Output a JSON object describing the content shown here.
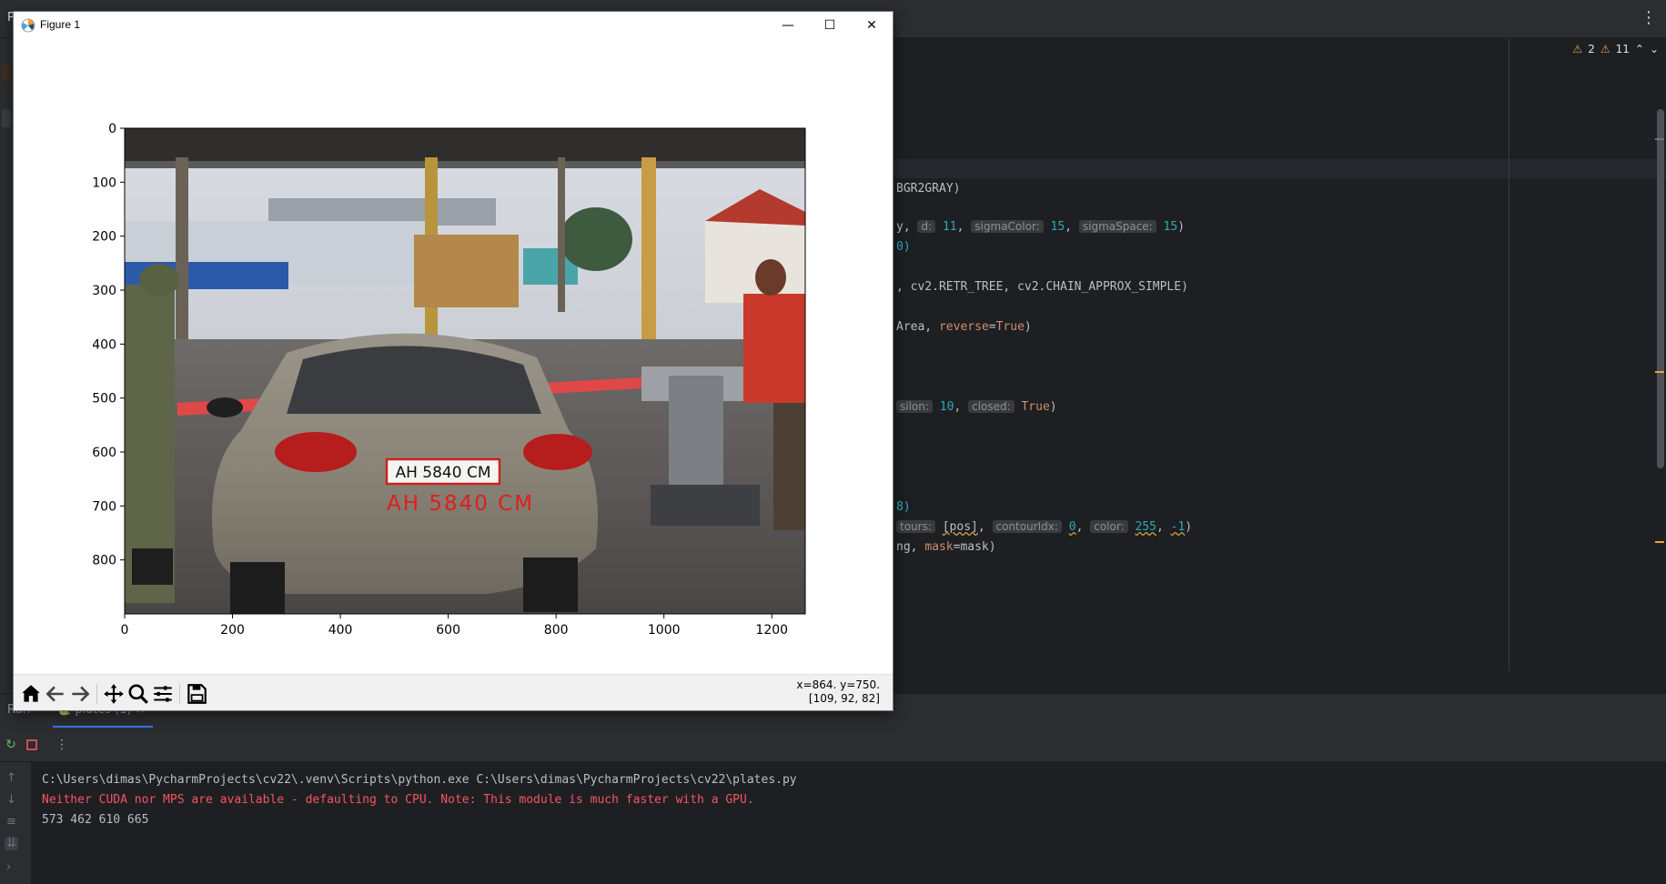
{
  "ide": {
    "title_fragment": "P",
    "more_icon": "vertical-dots-icon",
    "inspections": {
      "warnings": "2",
      "weak_warnings": "11"
    },
    "code_lines": [
      {
        "text": "BGR2GRAY)"
      },
      {
        "pre": "y, ",
        "hint1": "d:",
        "v1": "11",
        "hint2": "sigmaColor:",
        "v2": "15",
        "hint3": "sigmaSpace:",
        "v3": "15",
        "post": ")"
      },
      {
        "text": "0)"
      },
      {
        "text": ", cv2.RETR_TREE, cv2.CHAIN_APPROX_SIMPLE)"
      },
      {
        "pre": "Area, ",
        "kw": "reverse",
        "eq": "=",
        "val": "True",
        "post": ")"
      },
      {
        "hintA": "silon:",
        "vA": "10",
        "hintB": "closed:",
        "vB": "True",
        "post": ")"
      },
      {
        "text": "8)"
      },
      {
        "hintA": "tours:",
        "vA": "[pos]",
        "hintB": "contourIdx:",
        "vB": "0",
        "hintC": "color:",
        "vC": "255",
        "vD": "-1",
        "post": ")"
      },
      {
        "pre": "ng, ",
        "kw": "mask",
        "post": "=mask)"
      }
    ]
  },
  "run": {
    "tab_label": "Run",
    "config_tab": "plates (1)",
    "console": [
      {
        "text": "C:\\Users\\dimas\\PycharmProjects\\cv22\\.venv\\Scripts\\python.exe C:\\Users\\dimas\\PycharmProjects\\cv22\\plates.py",
        "kind": "normal"
      },
      {
        "text": "Neither CUDA nor MPS are available - defaulting to CPU. Note: This module is much faster with a GPU.",
        "kind": "error"
      },
      {
        "text": "573 462 610 665",
        "kind": "normal"
      }
    ]
  },
  "figure": {
    "window_title": "Figure 1",
    "controls": {
      "minimize": "—",
      "maximize": "☐",
      "close": "✕"
    },
    "plate_text": "AH 5840 CM",
    "overlay_text": "AH 5840 CM",
    "image_extent": {
      "x": [
        0,
        1262
      ],
      "y": [
        0,
        900
      ]
    },
    "xticks": [
      "0",
      "200",
      "400",
      "600",
      "800",
      "1000",
      "1200"
    ],
    "yticks": [
      "0",
      "100",
      "200",
      "300",
      "400",
      "500",
      "600",
      "700",
      "800"
    ],
    "status": {
      "coords": "x=864. y=750.",
      "pixel": "[109, 92, 82]"
    },
    "toolbar": [
      "home-icon",
      "back-icon",
      "forward-icon",
      "pan-icon",
      "zoom-icon",
      "configure-subplots-icon",
      "save-icon"
    ]
  }
}
